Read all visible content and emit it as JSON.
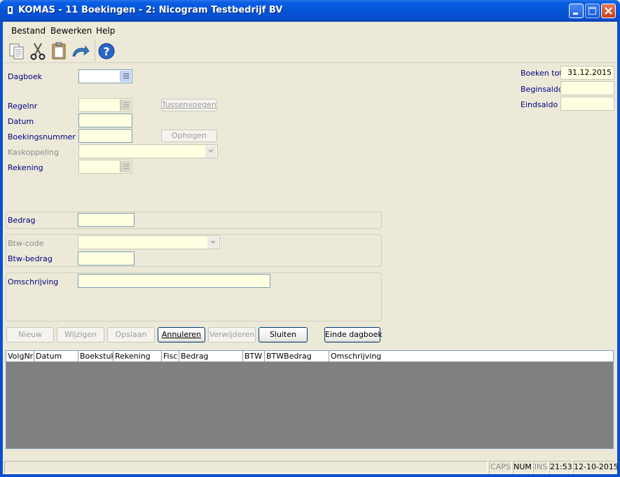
{
  "window": {
    "title": "KOMAS - 11 Boekingen - 2: Nicogram Testbedrijf BV"
  },
  "menu": [
    "Bestand",
    "Bewerken",
    "Help"
  ],
  "toolbar": {
    "icons": [
      "copy-icon",
      "cut-icon",
      "paste-icon",
      "undo-icon",
      "help-icon"
    ]
  },
  "form": {
    "dagboek": "Dagboek",
    "regelnr": "Regelnr",
    "datum": "Datum",
    "boekingsnummer": "Boekingsnummer",
    "kaskoppeling": "Kaskoppeling",
    "rekening": "Rekening",
    "bedrag": "Bedrag",
    "btw_code": "Btw-code",
    "btw_bedrag": "Btw-bedrag",
    "omschrijving": "Omschrijving",
    "tussenvoegen": "Tussenvoegen",
    "ophogen": "Ophogen"
  },
  "totals": {
    "boeken_tot_label": "Boeken tot",
    "boeken_tot_value": "31.12.2015",
    "beginsaldo_label": "Beginsaldo",
    "eindsaldo_label": "Eindsaldo"
  },
  "buttons": {
    "nieuw": "Nieuw",
    "wijzigen": "Wijzigen",
    "opslaan": "Opslaan",
    "annuleren": "Annuleren",
    "verwijderen": "Verwijderen",
    "sluiten": "Sluiten",
    "einde_dagboek": "Einde dagboek"
  },
  "grid": {
    "columns": [
      "VolgNr",
      "Datum",
      "Boekstuk",
      "Rekening",
      "Fisc",
      "Bedrag",
      "BTW",
      "BTWBedrag",
      "Omschrijving"
    ]
  },
  "status": {
    "caps": "CAPS",
    "num": "NUM",
    "ins": "INS",
    "time": "21:53",
    "date": "12-10-2015"
  },
  "colors": {
    "titlebar": "#0453D4",
    "field_bg": "#FFFFE1",
    "window_bg": "#ECE9D8",
    "label": "#000080"
  }
}
